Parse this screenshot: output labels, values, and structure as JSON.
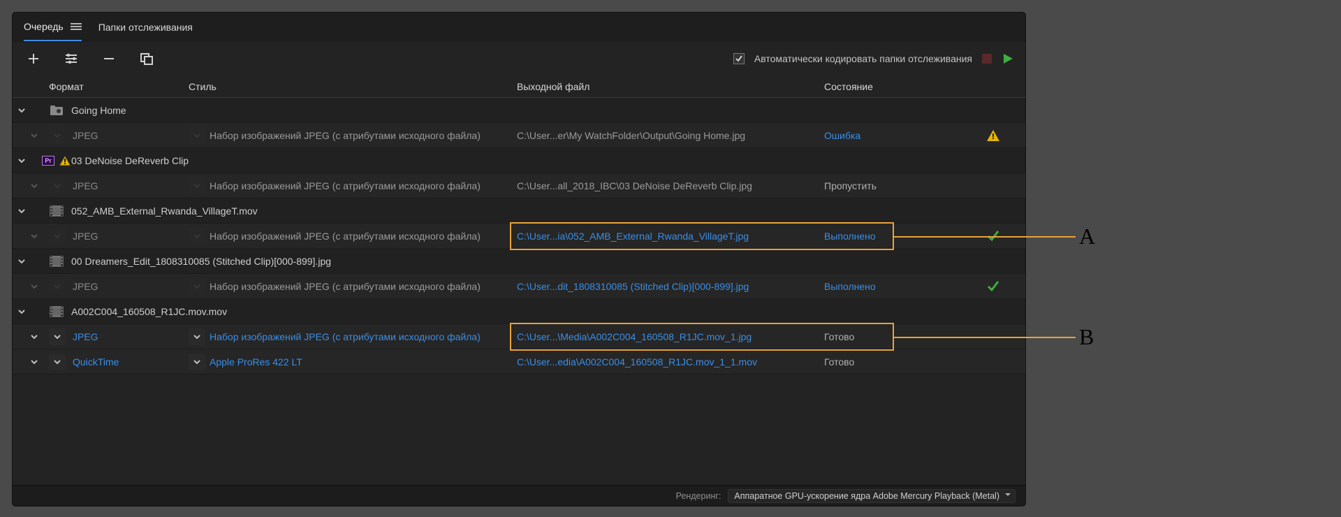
{
  "tabs": {
    "queue": "Очередь",
    "watch": "Папки отслеживания"
  },
  "toolbar": {
    "auto_encode_label": "Автоматически кодировать папки отслеживания"
  },
  "columns": {
    "format": "Формат",
    "preset": "Стиль",
    "output": "Выходной файл",
    "status": "Состояние"
  },
  "groups": [
    {
      "title": "Going Home",
      "icon": "folder-gear",
      "rows": [
        {
          "format": "JPEG",
          "preset": "Набор изображений JPEG (с атрибутами исходного файла)",
          "output": "C:\\User...er\\My WatchFolder\\Output\\Going Home.jpg",
          "status": "Ошибка",
          "status_style": "blue",
          "trail": "warning",
          "dim": true
        }
      ]
    },
    {
      "title": "03 DeNoise DeReverb Clip",
      "icon": "pr-warning",
      "rows": [
        {
          "format": "JPEG",
          "preset": "Набор изображений JPEG (с атрибутами исходного файла)",
          "output": "C:\\User...all_2018_IBC\\03 DeNoise DeReverb Clip.jpg",
          "status": "Пропустить",
          "status_style": "",
          "trail": "",
          "dim": true
        }
      ]
    },
    {
      "title": "052_AMB_External_Rwanda_VillageT.mov",
      "icon": "film",
      "rows": [
        {
          "format": "JPEG",
          "preset": "Набор изображений JPEG (с атрибутами исходного файла)",
          "output": "C:\\User...ia\\052_AMB_External_Rwanda_VillageT.jpg",
          "output_style": "blue",
          "status": "Выполнено",
          "status_style": "blue",
          "trail": "check",
          "dim": true,
          "highlight": "A"
        }
      ]
    },
    {
      "title": "00 Dreamers_Edit_1808310085 (Stitched Clip)[000-899].jpg",
      "icon": "film",
      "rows": [
        {
          "format": "JPEG",
          "preset": "Набор изображений JPEG (с атрибутами исходного файла)",
          "output": "C:\\User...dit_1808310085 (Stitched Clip)[000-899].jpg",
          "output_style": "blue",
          "status": "Выполнено",
          "status_style": "blue",
          "trail": "check",
          "dim": true
        }
      ]
    },
    {
      "title": "A002C004_160508_R1JC.mov.mov",
      "icon": "film",
      "rows": [
        {
          "format": "JPEG",
          "format_style": "blue",
          "preset": "Набор изображений JPEG (с атрибутами исходного файла)",
          "preset_style": "blue",
          "output": "C:\\User...\\Media\\A002C004_160508_R1JC.mov_1.jpg",
          "output_style": "blue",
          "status": "Готово",
          "status_style": "",
          "trail": "",
          "dim": false,
          "highlight": "B"
        },
        {
          "format": "QuickTime",
          "format_style": "blue",
          "preset": "Apple ProRes 422 LT",
          "preset_style": "blue",
          "output": "C:\\User...edia\\A002C004_160508_R1JC.mov_1_1.mov",
          "output_style": "blue",
          "status": "Готово",
          "status_style": "",
          "trail": "",
          "dim": false
        }
      ]
    }
  ],
  "footer": {
    "label": "Рендеринг:",
    "renderer": "Аппаратное GPU-ускорение ядра Adobe Mercury Playback (Metal)"
  },
  "callouts": {
    "A": "A",
    "B": "B"
  }
}
